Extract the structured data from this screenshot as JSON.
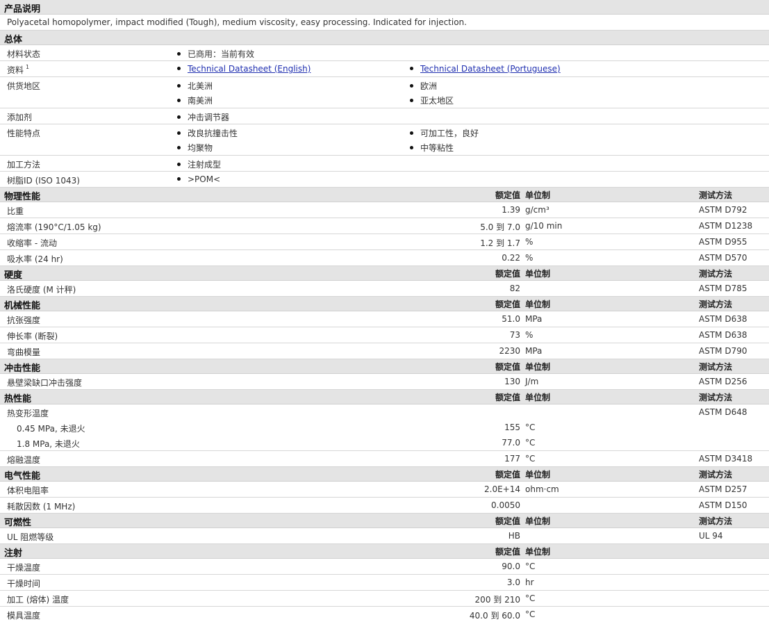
{
  "product_desc": {
    "title": "产品说明",
    "text": "Polyacetal homopolymer, impact modified (Tough), medium viscosity, easy processing. Indicated for injection."
  },
  "general": {
    "title": "总体",
    "material_status": {
      "label": "材料状态",
      "value": "已商用：当前有效"
    },
    "literature": {
      "label": "资料",
      "sup": "1",
      "link1": "Technical Datasheet (English)",
      "link2": "Technical Datasheet (Portuguese)"
    },
    "availability": {
      "label": "供货地区",
      "v1": "北美洲",
      "v2": "欧洲",
      "v3": "南美洲",
      "v4": "亚太地区"
    },
    "additive": {
      "label": "添加剂",
      "value": "冲击调节器"
    },
    "features": {
      "label": "性能特点",
      "v1": "改良抗撞击性",
      "v2": "可加工性，良好",
      "v3": "均聚物",
      "v4": "中等粘性"
    },
    "processing": {
      "label": "加工方法",
      "value": "注射成型"
    },
    "resin_id": {
      "label": "树脂ID (ISO 1043)",
      "value": ">POM<"
    }
  },
  "headers": {
    "nominal": "额定值",
    "unit": "单位制",
    "test": "测试方法"
  },
  "physical": {
    "title": "物理性能",
    "rows": [
      {
        "label": "比重",
        "value": "1.39",
        "unit": "g/cm³",
        "test": "ASTM D792"
      },
      {
        "label": "熔流率 (190°C/1.05 kg)",
        "value": "5.0 到  7.0",
        "unit": "g/10 min",
        "test": "ASTM D1238"
      },
      {
        "label": "收缩率 - 流动",
        "value": "1.2 到  1.7",
        "unit": "%",
        "test": "ASTM D955"
      },
      {
        "label": "吸水率 (24 hr)",
        "value": "0.22",
        "unit": "%",
        "test": "ASTM D570"
      }
    ]
  },
  "hardness": {
    "title": "硬度",
    "rows": [
      {
        "label": "洛氏硬度 (M 计秤)",
        "value": "82",
        "unit": "",
        "test": "ASTM D785"
      }
    ]
  },
  "mechanical": {
    "title": "机械性能",
    "rows": [
      {
        "label": "抗张强度",
        "value": "51.0",
        "unit": "MPa",
        "test": "ASTM D638"
      },
      {
        "label": "伸长率 (断裂)",
        "value": "73",
        "unit": "%",
        "test": "ASTM D638"
      },
      {
        "label": "弯曲模量",
        "value": "2230",
        "unit": "MPa",
        "test": "ASTM D790"
      }
    ]
  },
  "impact": {
    "title": "冲击性能",
    "rows": [
      {
        "label": "悬壁梁缺口冲击强度",
        "value": "130",
        "unit": "J/m",
        "test": "ASTM D256"
      }
    ]
  },
  "thermal": {
    "title": "热性能",
    "hdt": {
      "label": "热变形温度",
      "test": "ASTM D648"
    },
    "hdt1": {
      "label": "0.45 MPa, 未退火",
      "value": "155",
      "unit": "°C"
    },
    "hdt2": {
      "label": "1.8 MPa, 未退火",
      "value": "77.0",
      "unit": "°C"
    },
    "melt": {
      "label": "熔融温度",
      "value": "177",
      "unit": "°C",
      "test": "ASTM D3418"
    }
  },
  "electrical": {
    "title": "电气性能",
    "rows": [
      {
        "label": "体积电阻率",
        "value": "2.0E+14",
        "unit": "ohm·cm",
        "test": "ASTM D257"
      },
      {
        "label": "耗散因数 (1 MHz)",
        "value": "0.0050",
        "unit": "",
        "test": "ASTM D150"
      }
    ]
  },
  "flammability": {
    "title": "可燃性",
    "rows": [
      {
        "label": "UL 阻燃等级",
        "value": "HB",
        "unit": "",
        "test": "UL 94"
      }
    ]
  },
  "injection": {
    "title": "注射",
    "rows": [
      {
        "label": "干燥温度",
        "value": "90.0",
        "unit": "°C",
        "test": ""
      },
      {
        "label": "干燥时间",
        "value": "3.0",
        "unit": "hr",
        "test": ""
      },
      {
        "label": "加工 (熔体) 温度",
        "value": "200 到  210",
        "unit": "°C",
        "test": ""
      },
      {
        "label": "模具温度",
        "value": "40.0 到  60.0",
        "unit": "°C",
        "test": ""
      }
    ]
  }
}
